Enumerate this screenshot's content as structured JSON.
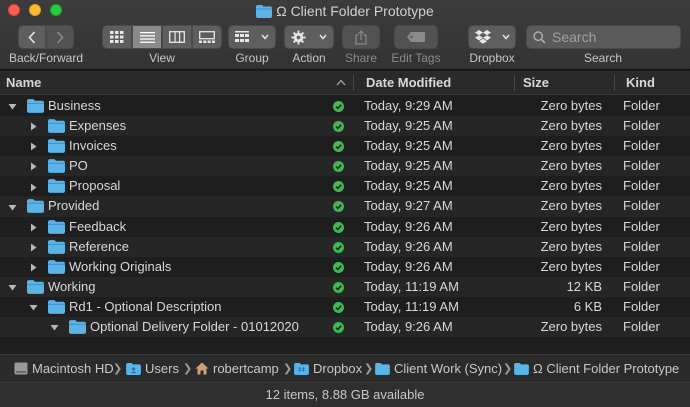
{
  "window": {
    "title": "Ω Client Folder Prototype"
  },
  "toolbar": {
    "back_forward_label": "Back/Forward",
    "view_label": "View",
    "group_label": "Group",
    "action_label": "Action",
    "share_label": "Share",
    "edit_tags_label": "Edit Tags",
    "dropbox_label": "Dropbox",
    "search_label": "Search",
    "search_placeholder": "Search"
  },
  "columns": {
    "name": "Name",
    "date_modified": "Date Modified",
    "size": "Size",
    "kind": "Kind"
  },
  "rows": [
    {
      "name": "Business",
      "date": "Today, 9:29 AM",
      "size": "Zero bytes",
      "kind": "Folder",
      "expanded": true
    },
    {
      "name": "Expenses",
      "date": "Today, 9:25 AM",
      "size": "Zero bytes",
      "kind": "Folder",
      "expanded": false
    },
    {
      "name": "Invoices",
      "date": "Today, 9:25 AM",
      "size": "Zero bytes",
      "kind": "Folder",
      "expanded": false
    },
    {
      "name": "PO",
      "date": "Today, 9:25 AM",
      "size": "Zero bytes",
      "kind": "Folder",
      "expanded": false
    },
    {
      "name": "Proposal",
      "date": "Today, 9:25 AM",
      "size": "Zero bytes",
      "kind": "Folder",
      "expanded": false
    },
    {
      "name": "Provided",
      "date": "Today, 9:27 AM",
      "size": "Zero bytes",
      "kind": "Folder",
      "expanded": true
    },
    {
      "name": "Feedback",
      "date": "Today, 9:26 AM",
      "size": "Zero bytes",
      "kind": "Folder",
      "expanded": false
    },
    {
      "name": "Reference",
      "date": "Today, 9:26 AM",
      "size": "Zero bytes",
      "kind": "Folder",
      "expanded": false
    },
    {
      "name": "Working Originals",
      "date": "Today, 9:26 AM",
      "size": "Zero bytes",
      "kind": "Folder",
      "expanded": false
    },
    {
      "name": "Working",
      "date": "Today, 11:19 AM",
      "size": "12 KB",
      "kind": "Folder",
      "expanded": true
    },
    {
      "name": "Rd1 - Optional Description",
      "date": "Today, 11:19 AM",
      "size": "6 KB",
      "kind": "Folder",
      "expanded": true
    },
    {
      "name": "Optional Delivery Folder - 01012020",
      "date": "Today, 9:26 AM",
      "size": "Zero bytes",
      "kind": "Folder",
      "expanded": true
    }
  ],
  "path": {
    "segments": [
      "Macintosh HD",
      "Users",
      "robertcamp",
      "Dropbox",
      "Client Work (Sync)",
      "Ω Client Folder Prototype"
    ]
  },
  "status": {
    "text": "12 items, 8.88 GB available"
  },
  "colors": {
    "folder": "#5ab4e8",
    "sync_ok": "#3fb950"
  }
}
